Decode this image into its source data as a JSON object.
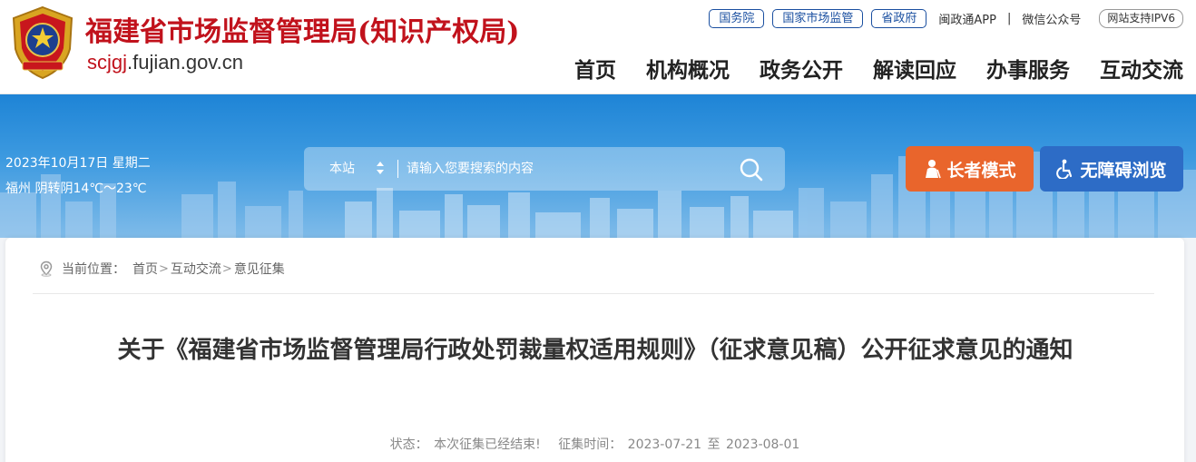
{
  "header": {
    "site_title": "福建省市场监督管理局(知识产权局)",
    "domain_prefix": "scjgj",
    "domain_suffix": ".fujian.gov.cn",
    "top_links": {
      "guowuyuan": "国务院",
      "national_market": "国家市场监管",
      "province_gov": "省政府",
      "mzt_app": "闽政通APP",
      "separator": "|",
      "wechat": "微信公众号",
      "ipv6": "网站支持IPV6"
    },
    "nav": [
      "首页",
      "机构概况",
      "政务公开",
      "解读回应",
      "办事服务",
      "互动交流"
    ]
  },
  "banner": {
    "date": "2023年10月17日 星期二",
    "weather": "福州 阴转阴14℃～23℃",
    "search": {
      "scope": "本站",
      "placeholder": "请输入您要搜索的内容"
    },
    "elder_mode": "长者模式",
    "accessible": "无障碍浏览"
  },
  "breadcrumb": {
    "label": "当前位置：",
    "items": [
      "首页",
      "互动交流",
      "意见征集"
    ],
    "separator": ">"
  },
  "article": {
    "title": "关于《福建省市场监督管理局行政处罚裁量权适用规则》（征求意见稿）公开征求意见的通知",
    "status_label": "状态：",
    "status_value": "本次征集已经结束!",
    "period_label": "征集时间：",
    "period_start": "2023-07-21",
    "period_to": "至",
    "period_end": "2023-08-01"
  },
  "colors": {
    "brand_red": "#c1121c",
    "pill_blue": "#1a4fa0",
    "elder_orange": "#e9652c",
    "access_blue": "#2d6cc6"
  }
}
